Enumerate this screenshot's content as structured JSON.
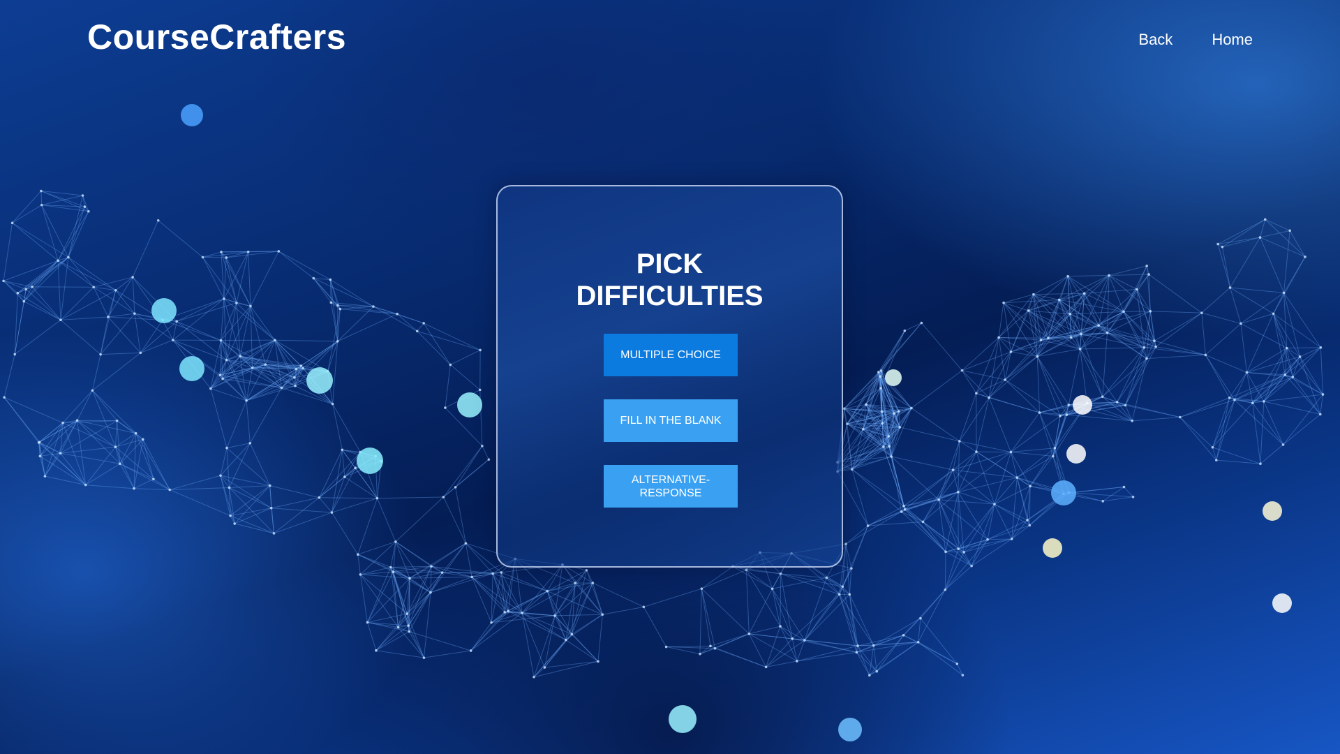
{
  "header": {
    "brand": "CourseCrafters",
    "nav": {
      "back": "Back",
      "home": "Home"
    }
  },
  "card": {
    "title": "PICK\nDIFFICULTIES",
    "options": [
      {
        "label": "MULTIPLE CHOICE"
      },
      {
        "label": "FILL IN THE BLANK"
      },
      {
        "label": "ALTERNATIVE-RESPONSE"
      }
    ]
  },
  "colors": {
    "primary_button": "#0b7be0",
    "secondary_button": "#3aa1f2",
    "background_dark": "#041d55",
    "background_light": "#1756c4"
  }
}
